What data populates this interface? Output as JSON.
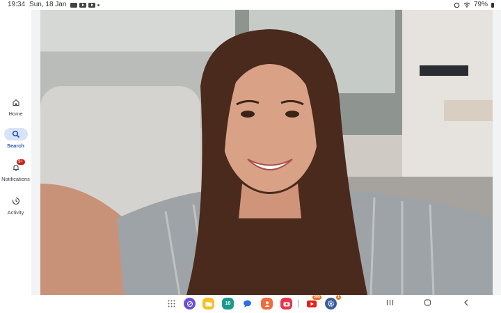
{
  "status_bar": {
    "time": "19:34",
    "date": "Sun, 18 Jan",
    "battery": "79%"
  },
  "nav": {
    "items": [
      {
        "label": "Home",
        "icon": "home-icon",
        "active": false
      },
      {
        "label": "Search",
        "icon": "search-icon",
        "active": true
      },
      {
        "label": "Notifications",
        "icon": "bell-icon",
        "badge": "9+",
        "active": false
      },
      {
        "label": "Activity",
        "icon": "clock-icon",
        "active": false
      }
    ]
  },
  "taskbar": {
    "apps": [
      {
        "name": "app-grid",
        "icon": "app-grid-icon"
      },
      {
        "name": "browser",
        "icon": "browser-icon"
      },
      {
        "name": "files",
        "icon": "folder-icon"
      },
      {
        "name": "calendar",
        "icon": "calendar-icon",
        "label": "18"
      },
      {
        "name": "messages",
        "icon": "chat-icon"
      },
      {
        "name": "contacts",
        "icon": "contacts-icon"
      },
      {
        "name": "camera",
        "icon": "camera-icon"
      },
      {
        "name": "youtube",
        "icon": "youtube-icon",
        "badge": "305"
      },
      {
        "name": "settings",
        "icon": "gear-icon",
        "badge": "1"
      }
    ]
  },
  "colors": {
    "accent": "#1a56b8",
    "active_pill": "#d8e3f8",
    "badge_red": "#c5221f",
    "frame_gray": "#f1f3f4"
  }
}
